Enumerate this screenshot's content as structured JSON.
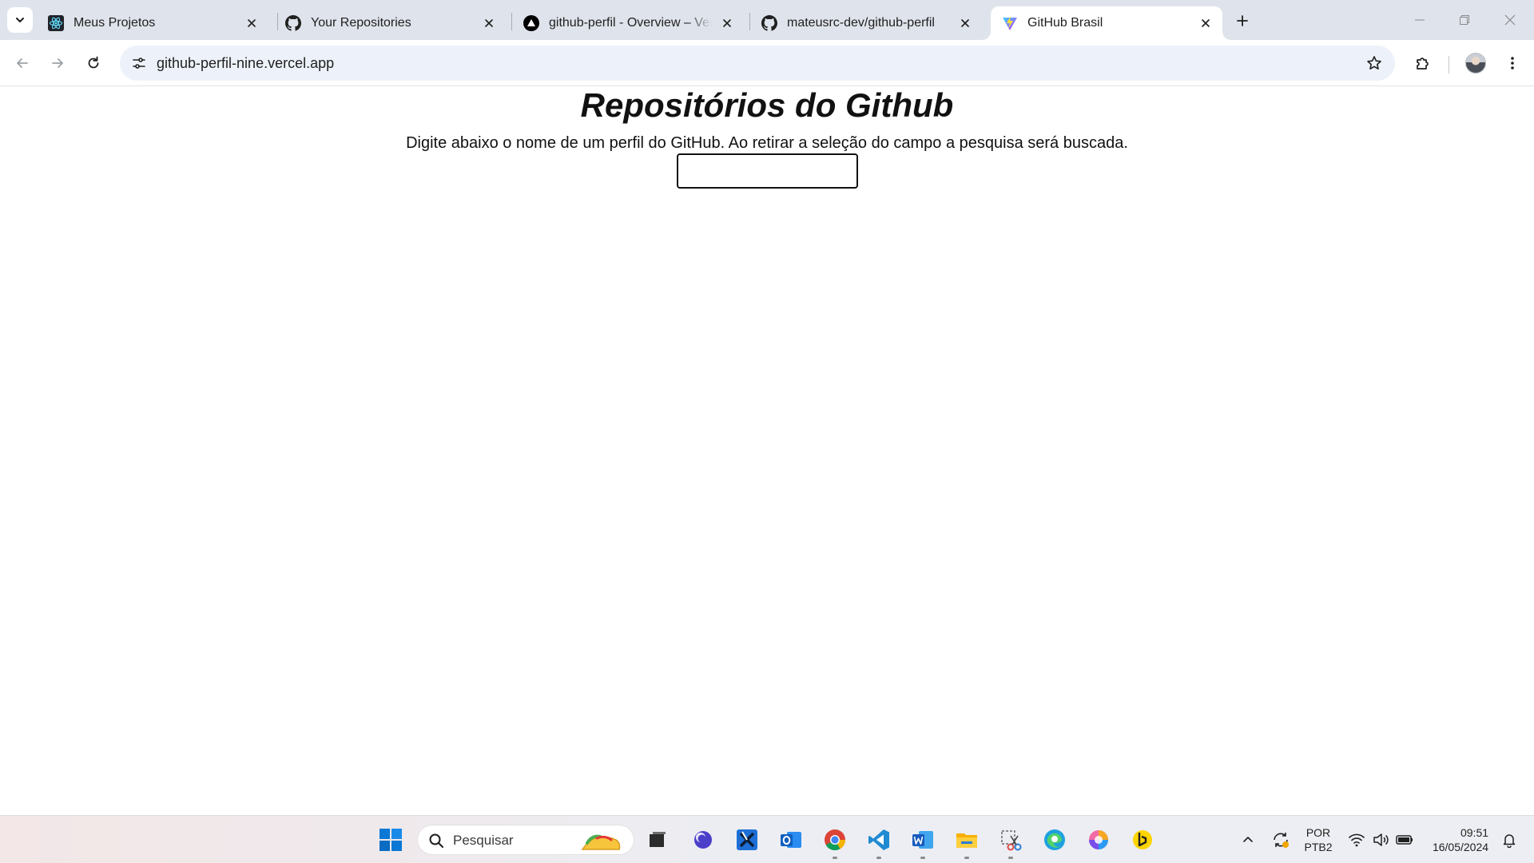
{
  "browser": {
    "tabs": [
      {
        "title": "Meus Projetos",
        "icon": "react-icon",
        "active": false
      },
      {
        "title": "Your Repositories",
        "icon": "github-icon",
        "active": false
      },
      {
        "title": "github-perfil - Overview – Vercel",
        "icon": "vercel-icon",
        "active": false
      },
      {
        "title": "mateusrc-dev/github-perfil",
        "icon": "github-icon",
        "active": false
      },
      {
        "title": "GitHub Brasil",
        "icon": "vite-icon",
        "active": true
      }
    ],
    "address_bar": {
      "url": "github-perfil-nine.vercel.app"
    }
  },
  "page": {
    "title": "Repositórios do Github",
    "description": "Digite abaixo o nome de um perfil do GitHub. Ao retirar a seleção do campo a pesquisa será buscada.",
    "search_input": {
      "value": "",
      "placeholder": ""
    }
  },
  "taskbar": {
    "search_placeholder": "Pesquisar",
    "pinned": [
      "start-icon",
      "task-view-icon",
      "purple-app-icon",
      "capcut-icon",
      "outlook-icon",
      "chrome-icon",
      "vscode-icon",
      "word-icon",
      "file-explorer-icon",
      "snipping-tool-icon",
      "edge-icon",
      "copilot-icon",
      "bing-icon"
    ],
    "language": {
      "line1": "POR",
      "line2": "PTB2"
    },
    "clock": {
      "time": "09:51",
      "date": "16/05/2024"
    }
  }
}
